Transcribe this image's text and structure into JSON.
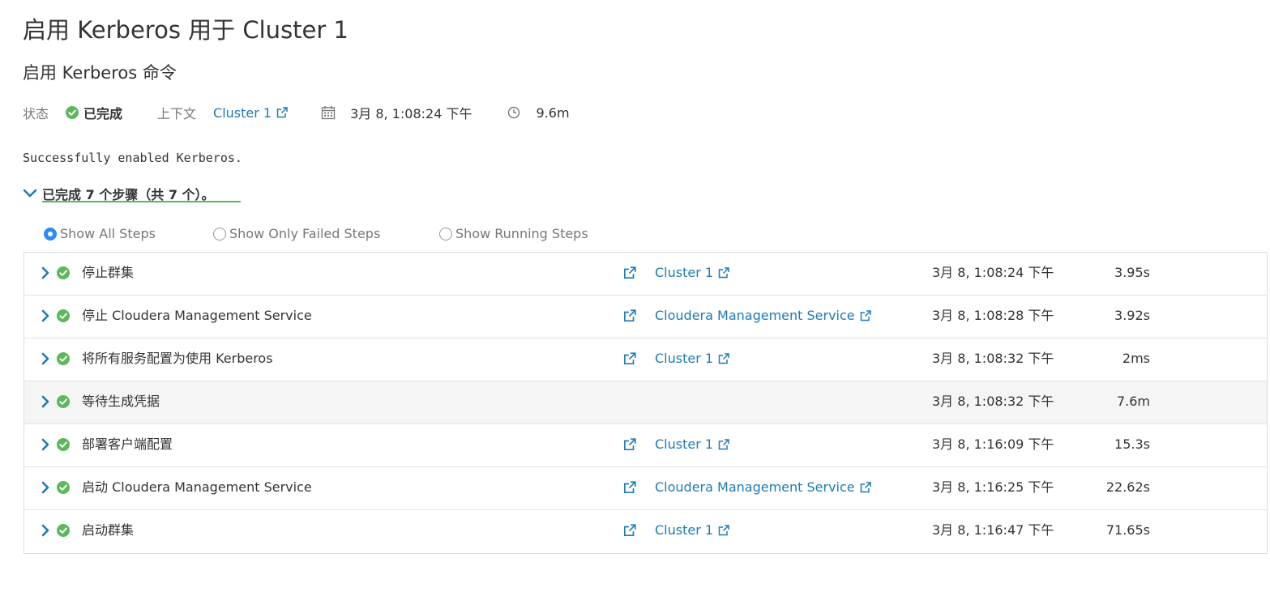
{
  "header": {
    "title": "启用 Kerberos 用于 Cluster 1",
    "subtitle": "启用 Kerberos 命令"
  },
  "meta": {
    "status_label": "状态",
    "status_value": "已完成",
    "context_label": "上下文",
    "context_link": "Cluster 1",
    "date": "3月 8, 1:08:24 下午",
    "duration": "9.6m"
  },
  "message": "Successfully enabled Kerberos.",
  "summary": "已完成 7 个步骤（共 7 个）。",
  "filters": [
    {
      "label": "Show All Steps",
      "checked": true
    },
    {
      "label": "Show Only Failed Steps",
      "checked": false
    },
    {
      "label": "Show Running Steps",
      "checked": false
    }
  ],
  "steps": [
    {
      "name": "停止群集",
      "context": "Cluster 1",
      "time": "3月 8, 1:08:24 下午",
      "duration": "3.95s"
    },
    {
      "name": "停止 Cloudera Management Service",
      "context": "Cloudera Management Service",
      "time": "3月 8, 1:08:28 下午",
      "duration": "3.92s"
    },
    {
      "name": "将所有服务配置为使用 Kerberos",
      "context": "Cluster 1",
      "time": "3月 8, 1:08:32 下午",
      "duration": "2ms"
    },
    {
      "name": "等待生成凭据",
      "context": "",
      "time": "3月 8, 1:08:32 下午",
      "duration": "7.6m"
    },
    {
      "name": "部署客户端配置",
      "context": "Cluster 1",
      "time": "3月 8, 1:16:09 下午",
      "duration": "15.3s"
    },
    {
      "name": "启动 Cloudera Management Service",
      "context": "Cloudera Management Service",
      "time": "3月 8, 1:16:25 下午",
      "duration": "22.62s"
    },
    {
      "name": "启动群集",
      "context": "Cluster 1",
      "time": "3月 8, 1:16:47 下午",
      "duration": "71.65s"
    }
  ],
  "icons": {
    "status": "check-circle-icon",
    "external_link": "external-link-icon",
    "calendar": "calendar-icon",
    "clock": "clock-icon",
    "expand": "chevron-right-icon",
    "collapse": "chevron-down-icon"
  },
  "colors": {
    "success": "#5cb85c",
    "link": "#1f7ab5",
    "radio_selected": "#2d8cf0",
    "chevron": "#1f7ab5"
  }
}
